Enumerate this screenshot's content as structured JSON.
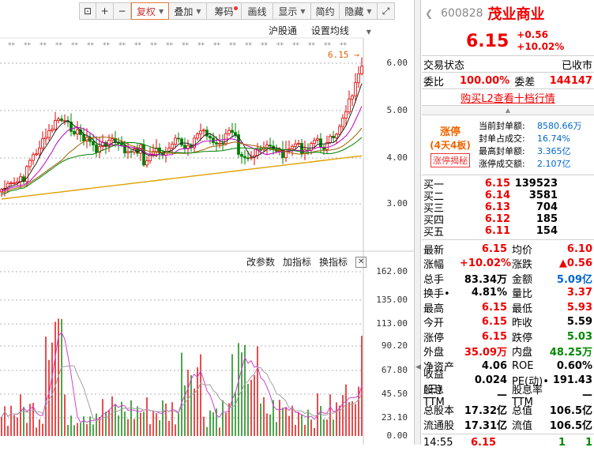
{
  "toolbar": {
    "buttons": [
      {
        "label": "",
        "icon": "lock-icon"
      },
      {
        "label": "+"
      },
      {
        "label": "−"
      },
      {
        "label": "复权",
        "dropdown": true,
        "active": true
      },
      {
        "label": "叠加",
        "dropdown": true
      },
      {
        "label": "筹码",
        "dot": true
      },
      {
        "label": "画线"
      },
      {
        "label": "显示",
        "dropdown": true
      },
      {
        "label": "简约"
      },
      {
        "label": "隐藏",
        "dropdown": true
      },
      {
        "label": "",
        "icon": "fullscreen-icon"
      }
    ],
    "index_name": "沪股通",
    "setting": "设置均线"
  },
  "price_chart": {
    "y_ticks": [
      "6.00",
      "5.00",
      "4.00",
      "3.00"
    ],
    "current_price_marker": "6.15",
    "colors": {
      "bg": "#ffffff",
      "up": "#e00000",
      "down": "#008000",
      "ma5": "#222222",
      "ma10": "#c000c0",
      "ma20": "#a06000",
      "ma30": "#008000",
      "ma60": "#e0a000"
    }
  },
  "volume_chart": {
    "toolbar": [
      "改参数",
      "加指标",
      "换指标"
    ],
    "y_ticks": [
      "162.00",
      "135.00",
      "113.00",
      "90.20",
      "67.80",
      "45.50",
      "23.10",
      "0.00"
    ]
  },
  "quote": {
    "code": "600828",
    "name": "茂业商业",
    "price": "6.15",
    "change": "+0.56",
    "change_pct": "+10.02%",
    "status_label": "交易状态",
    "status_value": "已收市",
    "weibi_label": "委比",
    "weibi_value": "100.00%",
    "weicha_label": "委差",
    "weicha_value": "144147",
    "l2_link": "购买L2查看十档行情",
    "limit": {
      "title": "涨停",
      "days": "(4天4板)",
      "reveal": "涨停揭秘",
      "rows": [
        {
          "label": "当前封单额:",
          "value": "8580.66万"
        },
        {
          "label": "封单占成交:",
          "value": "16.74%"
        },
        {
          "label": "最高封单额:",
          "value": "3.365亿"
        },
        {
          "label": "涨停成交额:",
          "value": "2.107亿"
        }
      ]
    },
    "bids": [
      {
        "label": "买一",
        "price": "6.15",
        "vol": "139523"
      },
      {
        "label": "买二",
        "price": "6.14",
        "vol": "3581"
      },
      {
        "label": "买三",
        "price": "6.13",
        "vol": "704"
      },
      {
        "label": "买四",
        "price": "6.12",
        "vol": "185"
      },
      {
        "label": "买五",
        "price": "6.11",
        "vol": "154"
      }
    ],
    "stats": [
      {
        "l1": "最新",
        "v1": "6.15",
        "c1": "red",
        "l2": "均价",
        "v2": "6.10",
        "c2": "red"
      },
      {
        "l1": "涨幅",
        "v1": "+10.02%",
        "c1": "red",
        "l2": "涨跌",
        "v2": "▲0.56",
        "c2": "red"
      },
      {
        "l1": "总手",
        "v1": "83.34万",
        "c1": "black",
        "l2": "金额",
        "v2": "5.09亿",
        "c2": "blue"
      },
      {
        "l1": "换手•",
        "v1": "4.81%",
        "c1": "black",
        "l2": "量比",
        "v2": "3.37",
        "c2": "red"
      },
      {
        "l1": "最高",
        "v1": "6.15",
        "c1": "red",
        "l2": "最低",
        "v2": "5.93",
        "c2": "red"
      },
      {
        "l1": "今开",
        "v1": "6.15",
        "c1": "red",
        "l2": "昨收",
        "v2": "5.59",
        "c2": "black"
      },
      {
        "l1": "涨停",
        "v1": "6.15",
        "c1": "red",
        "l2": "跌停",
        "v2": "5.03",
        "c2": "green"
      },
      {
        "l1": "外盘",
        "v1": "35.09万",
        "c1": "red",
        "l2": "内盘",
        "v2": "48.25万",
        "c2": "green"
      },
      {
        "l1": "净资产",
        "v1": "4.06",
        "c1": "black",
        "l2": "ROE",
        "v2": "0.60%",
        "c2": "black"
      },
      {
        "l1": "收益(三)",
        "v1": "0.024",
        "c1": "black",
        "l2": "PE(动)•",
        "v2": "191.43",
        "c2": "black"
      },
      {
        "l1": "股息TTM",
        "v1": "—",
        "c1": "black",
        "l2": "股息率TTM",
        "v2": "—",
        "c2": "black"
      },
      {
        "l1": "总股本",
        "v1": "17.32亿",
        "c1": "black",
        "l2": "总值",
        "v2": "106.5亿",
        "c2": "black"
      },
      {
        "l1": "流通股",
        "v1": "17.31亿",
        "c1": "black",
        "l2": "流值",
        "v2": "106.5亿",
        "c2": "black"
      }
    ],
    "tick": {
      "time": "14:55",
      "price": "6.15",
      "vol": "1",
      "count": "1"
    }
  }
}
